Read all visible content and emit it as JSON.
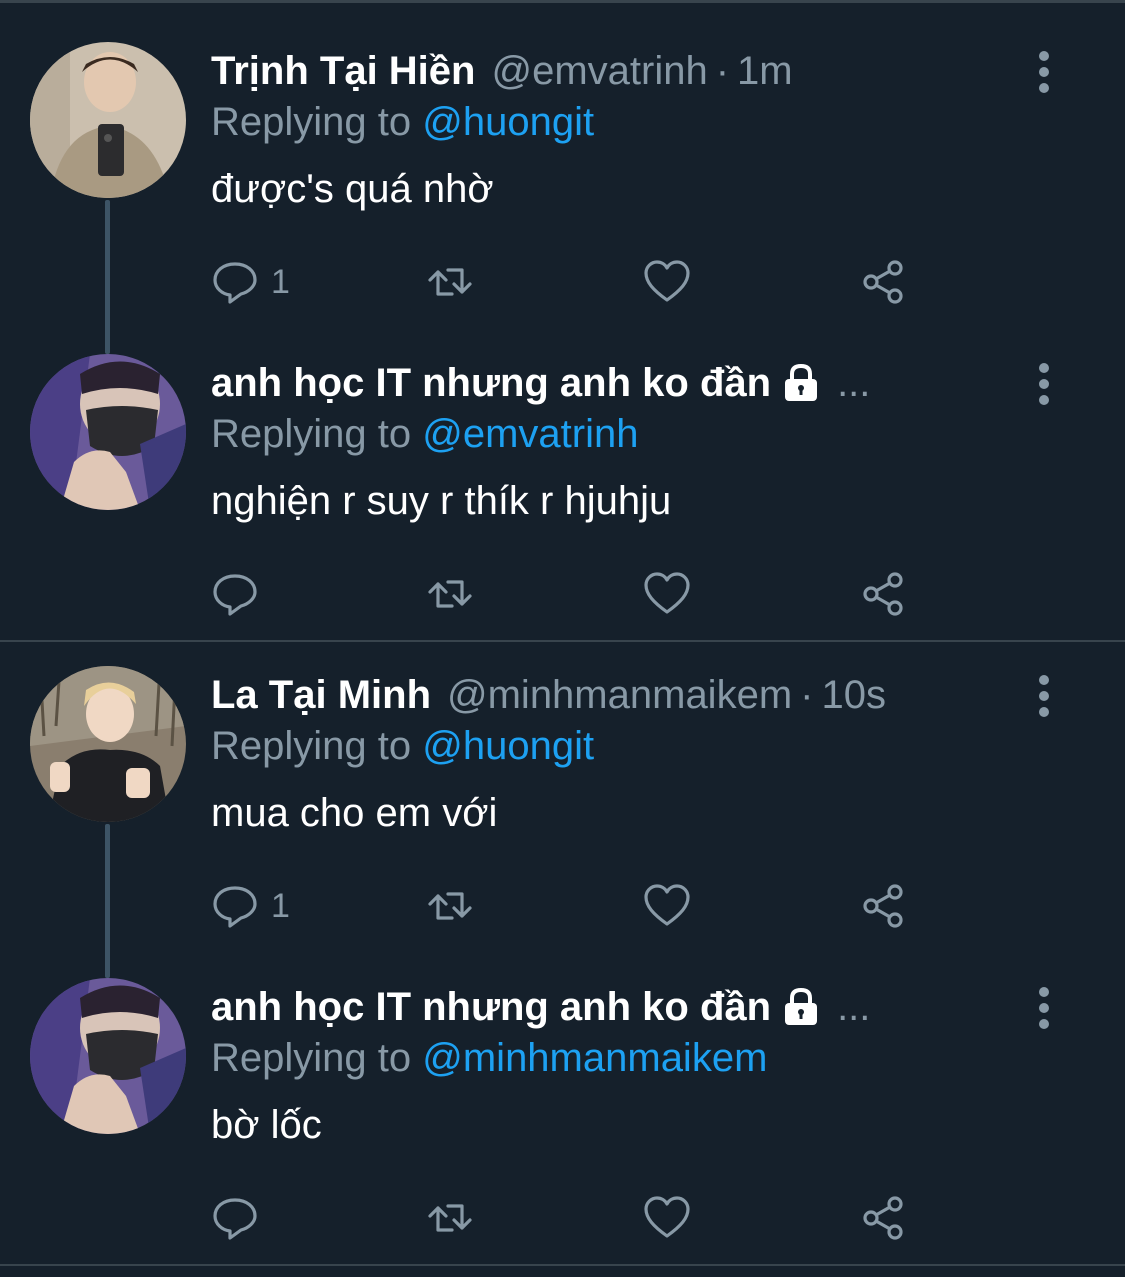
{
  "threads": [
    {
      "tweets": [
        {
          "name": "Trịnh Tại Hiền",
          "locked": false,
          "handle": "@emvatrinh",
          "separator": "·",
          "time": "1m",
          "replying_prefix": "Replying to",
          "replying_to": "@huongit",
          "text": "được's quá nhờ",
          "reply_count": "1",
          "avatar": "avatar-photo-mirror-selfie"
        },
        {
          "name": "anh học IT nhưng anh ko đần",
          "locked": true,
          "handle": "...",
          "separator": "",
          "time": "",
          "replying_prefix": "Replying to",
          "replying_to": "@emvatrinh",
          "text": "nghiện r suy r thík r hjuhju",
          "reply_count": "",
          "avatar": "avatar-photo-masked-thumbs-up"
        }
      ]
    },
    {
      "tweets": [
        {
          "name": "La Tại Minh",
          "locked": false,
          "handle": "@minhmanmaikem",
          "separator": "·",
          "time": "10s",
          "replying_prefix": "Replying to",
          "replying_to": "@huongit",
          "text": "mua cho em với",
          "reply_count": "1",
          "avatar": "avatar-photo-outdoor-thumbs-up"
        },
        {
          "name": "anh học IT nhưng anh ko đần",
          "locked": true,
          "handle": "...",
          "separator": "",
          "time": "",
          "replying_prefix": "Replying to",
          "replying_to": "@minhmanmaikem",
          "text": "bờ lốc",
          "reply_count": "",
          "avatar": "avatar-photo-masked-thumbs-up"
        }
      ]
    }
  ],
  "icons": {
    "reply": "reply-icon",
    "retweet": "retweet-icon",
    "like": "like-icon",
    "share": "share-icon",
    "more": "more-options-icon",
    "lock": "lock-icon"
  },
  "colors": {
    "background": "#15202b",
    "divider": "#38444d",
    "secondary_text": "#8899a6",
    "link": "#1da1f2",
    "primary_text": "#ffffff"
  }
}
